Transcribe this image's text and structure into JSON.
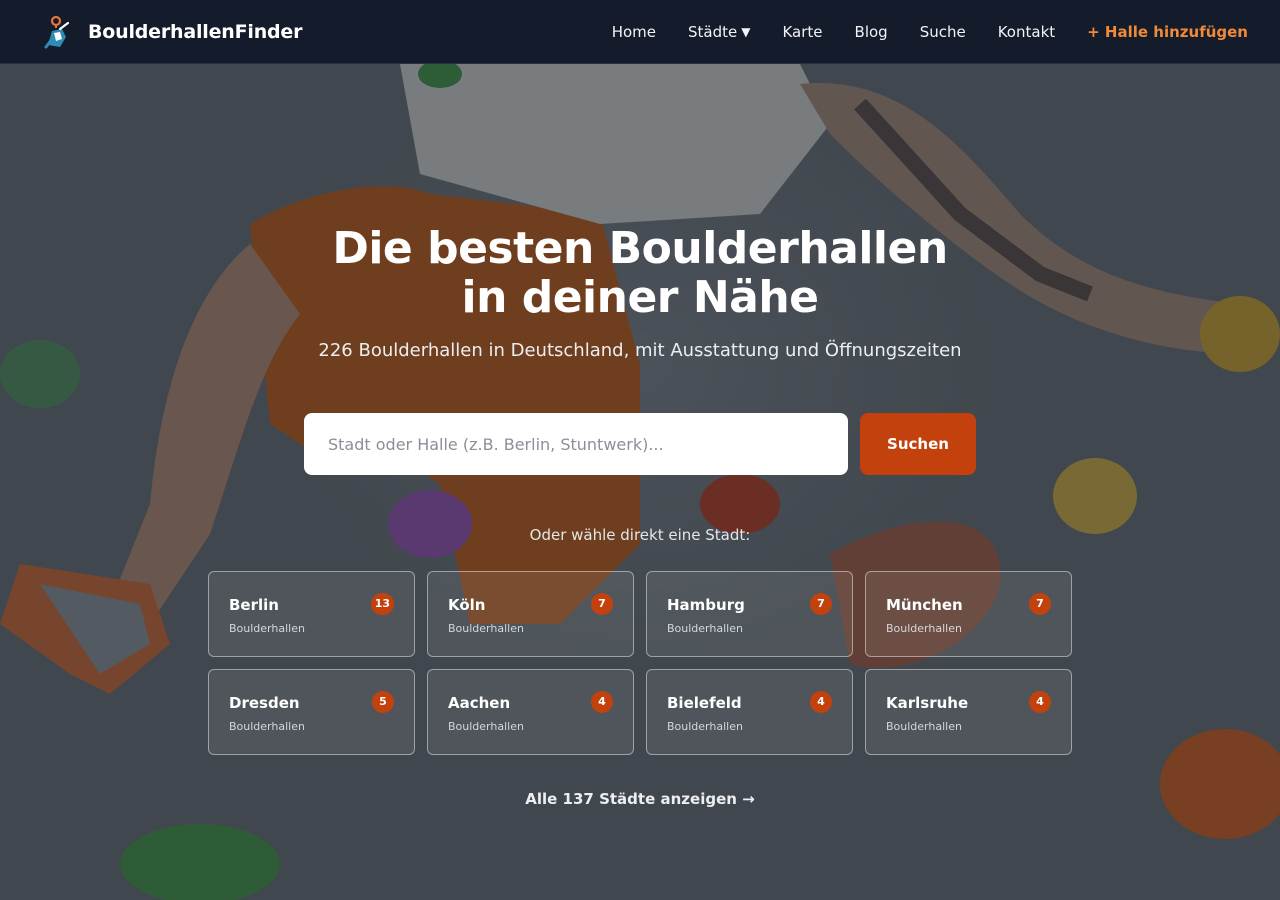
{
  "nav": {
    "brand": "BoulderhallenFinder",
    "links": [
      {
        "label": "Home"
      },
      {
        "label": "Städte",
        "dropdown": true
      },
      {
        "label": "Karte"
      },
      {
        "label": "Blog"
      },
      {
        "label": "Suche"
      },
      {
        "label": "Kontakt"
      }
    ],
    "dropdown_caret": "▼",
    "cta": "+ Halle hinzufügen"
  },
  "hero": {
    "title_line1": "Die besten Boulderhallen",
    "title_line2": "in deiner Nähe",
    "subtitle": "226 Boulderhallen in Deutschland, mit Ausstattung und Öffnungszeiten",
    "background": "photo of a climber on a bouldering wall with colorful holds"
  },
  "search": {
    "placeholder": "Stadt oder Halle (z.B. Berlin, Stuntwerk)...",
    "value": "",
    "button": "Suchen"
  },
  "cities": {
    "label": "Oder wähle direkt eine Stadt:",
    "items": [
      {
        "name": "Berlin",
        "sub": "Boulderhallen",
        "count": "13"
      },
      {
        "name": "Köln",
        "sub": "Boulderhallen",
        "count": "7"
      },
      {
        "name": "Hamburg",
        "sub": "Boulderhallen",
        "count": "7"
      },
      {
        "name": "München",
        "sub": "Boulderhallen",
        "count": "7"
      },
      {
        "name": "Dresden",
        "sub": "Boulderhallen",
        "count": "5"
      },
      {
        "name": "Aachen",
        "sub": "Boulderhallen",
        "count": "4"
      },
      {
        "name": "Bielefeld",
        "sub": "Boulderhallen",
        "count": "4"
      },
      {
        "name": "Karlsruhe",
        "sub": "Boulderhallen",
        "count": "4"
      }
    ],
    "all_link": "Alle 137 Städte anzeigen →"
  },
  "colors": {
    "nav_bg": "#141b2b",
    "accent": "#c2410c",
    "cta": "#f08a3b"
  }
}
